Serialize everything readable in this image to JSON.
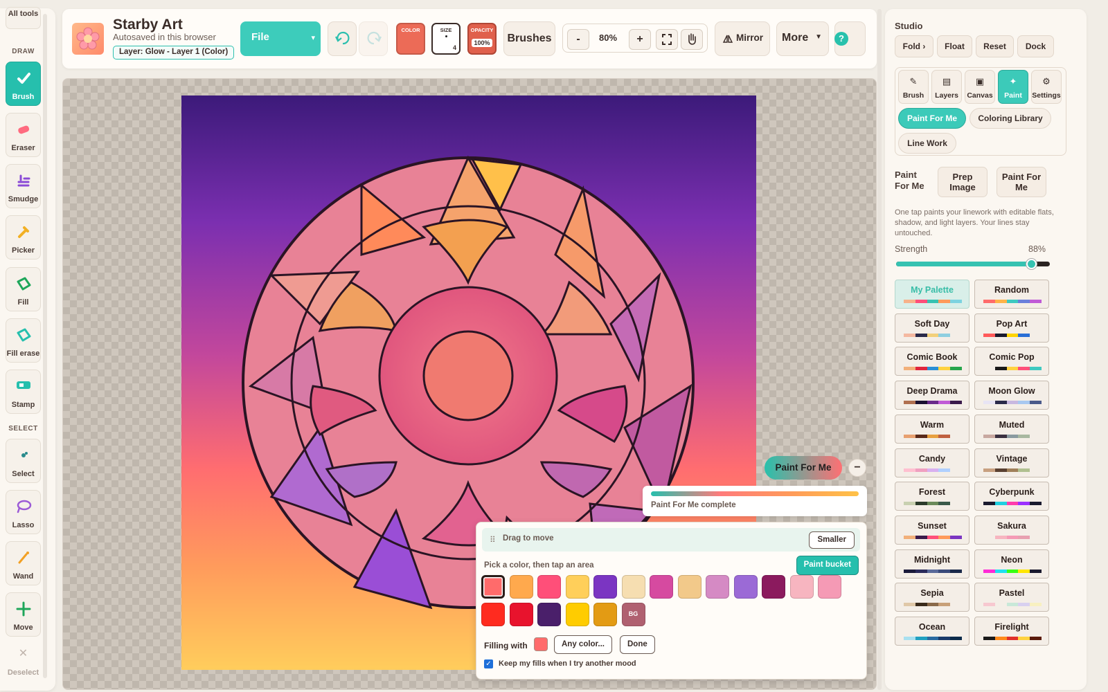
{
  "left_tools": {
    "all_tools": "All tools",
    "draw_heading": "DRAW",
    "select_heading": "SELECT",
    "brush": "Brush",
    "eraser": "Eraser",
    "smudge": "Smudge",
    "picker": "Picker",
    "fill": "Fill",
    "fill_erase": "Fill erase",
    "stamp": "Stamp",
    "select": "Select",
    "lasso": "Lasso",
    "wand": "Wand",
    "move": "Move",
    "deselect": "Deselect"
  },
  "header": {
    "app_title": "Starby Art",
    "autosave": "Autosaved in this browser",
    "layer": "Layer: Glow - Layer 1 (Color)",
    "file": "File",
    "color_label": "COLOR",
    "color_value": "#ec6b57",
    "size_label": "SIZE",
    "size_value": "4",
    "opacity_label": "OPACITY",
    "opacity_value": "100%",
    "brushes": "Brushes",
    "zoom_minus": "-",
    "zoom_level": "80%",
    "zoom_plus": "+",
    "mirror": "Mirror",
    "more": "More"
  },
  "canvas": {
    "paint_for_me_button": "Paint For Me",
    "minimize": "−",
    "progress_text": "Paint For Me complete"
  },
  "color_panel": {
    "drag_label": "Drag to move",
    "smaller": "Smaller",
    "instruction": "Pick a color, then tap an area",
    "paint_bucket": "Paint bucket",
    "row1": [
      "#ff6b6b",
      "#ffa94d",
      "#ff4f79",
      "#ffcf5a",
      "#7b35c2",
      "#f6deb1",
      "#d64aa0",
      "#f2c98a",
      "#d58ac4",
      "#9b6ad6",
      "#8b1a5e",
      "#f7b5c0",
      "#f59ab5"
    ],
    "row2": [
      "#ff2b1f",
      "#e8132d",
      "#4a1f6a",
      "#ffcc00",
      "#e39b14"
    ],
    "bg_label": "BG",
    "bg_color": "#b06070",
    "filling_with": "Filling with",
    "filling_color": "#ff6b6b",
    "any_color": "Any color...",
    "done": "Done",
    "keep_fills": "Keep my fills when I try another mood"
  },
  "studio": {
    "title": "Studio",
    "fold": "Fold ›",
    "float": "Float",
    "reset": "Reset",
    "dock": "Dock",
    "tabs": [
      "Brush",
      "Layers",
      "Canvas",
      "Paint",
      "Settings"
    ],
    "subtabs": [
      "Paint For Me",
      "Coloring Library",
      "Line Work"
    ],
    "section_label": "Paint For Me",
    "prep_image": "Prep Image",
    "paint_for_me": "Paint For Me",
    "description": "One tap paints your linework with editable flats, shadow, and light layers. Your lines stay untouched.",
    "strength_label": "Strength",
    "strength_value": "88%",
    "strength_fraction": 0.88,
    "palettes": [
      {
        "name": "My Palette",
        "colors": [
          "#f7b28a",
          "#ff4f79",
          "#36c2b1",
          "#ff9a5a",
          "#7dd3e0"
        ]
      },
      {
        "name": "Random",
        "colors": [
          "#ff6b6b",
          "#ffb347",
          "#3ec9c0",
          "#6a7fdb",
          "#c05ad6"
        ]
      },
      {
        "name": "Soft Day",
        "colors": [
          "#f4b8a0",
          "#2a2a4a",
          "#f2d07a",
          "#8ecfe0",
          "#f4eee7"
        ]
      },
      {
        "name": "Pop Art",
        "colors": [
          "#ff5a5a",
          "#1a1a2e",
          "#ffd400",
          "#2a6fd6",
          "#f4eee7"
        ]
      },
      {
        "name": "Comic Book",
        "colors": [
          "#f2b07a",
          "#e0243c",
          "#2a8fd6",
          "#ffd23f",
          "#27a54c"
        ]
      },
      {
        "name": "Comic Pop",
        "colors": [
          "#f4eee7",
          "#1a1a1a",
          "#ffd23f",
          "#ff4f79",
          "#3ec9c0"
        ]
      },
      {
        "name": "Deep Drama",
        "colors": [
          "#b07050",
          "#1a1030",
          "#6a2a8a",
          "#c05ad6",
          "#3a1a4a"
        ]
      },
      {
        "name": "Moon Glow",
        "colors": [
          "#e8e4f4",
          "#2a2a4a",
          "#c8b8e0",
          "#a8c8f0",
          "#4a5a8a"
        ]
      },
      {
        "name": "Warm",
        "colors": [
          "#e8a070",
          "#5a2a1a",
          "#e8a040",
          "#c06040",
          "#f4eee7"
        ]
      },
      {
        "name": "Muted",
        "colors": [
          "#c8a8a0",
          "#3a3040",
          "#8a9aa0",
          "#a8b8a0",
          "#f4eee7"
        ]
      },
      {
        "name": "Candy",
        "colors": [
          "#ffc0d0",
          "#f0a0c0",
          "#d8b0f0",
          "#b0d0ff",
          "#f4eee7"
        ]
      },
      {
        "name": "Vintage",
        "colors": [
          "#c8a080",
          "#5a4030",
          "#a0805a",
          "#b0c090",
          "#f4eee7"
        ]
      },
      {
        "name": "Forest",
        "colors": [
          "#c8d0b0",
          "#2a3a2a",
          "#6a8a5a",
          "#3a5a4a",
          "#f4eee7"
        ]
      },
      {
        "name": "Cyberpunk",
        "colors": [
          "#1a1a2e",
          "#20d0e0",
          "#ff3cac",
          "#9b30ff",
          "#1a1a2e"
        ]
      },
      {
        "name": "Sunset",
        "colors": [
          "#f2b07a",
          "#3a1a4a",
          "#ff4f79",
          "#ff9a5a",
          "#7b35c2"
        ]
      },
      {
        "name": "Sakura",
        "colors": [
          "#f4eee7",
          "#f7b5c0",
          "#f59ab5",
          "#e8a0b0",
          "#f4eee7"
        ]
      },
      {
        "name": "Midnight",
        "colors": [
          "#1a1a3a",
          "#2a2a5a",
          "#5a6a9a",
          "#3a4a7a",
          "#1a2a4a"
        ]
      },
      {
        "name": "Neon",
        "colors": [
          "#ff2bd6",
          "#20e0f0",
          "#39ff14",
          "#ffe600",
          "#1a1a2e"
        ]
      },
      {
        "name": "Sepia",
        "colors": [
          "#e0c8a8",
          "#3a2a1a",
          "#8a6a4a",
          "#c8a078",
          "#f4eee7"
        ]
      },
      {
        "name": "Pastel",
        "colors": [
          "#f7c8d0",
          "#f4eee7",
          "#c8e8d8",
          "#d8d0f0",
          "#f8f0c0"
        ]
      },
      {
        "name": "Ocean",
        "colors": [
          "#a8e0f0",
          "#20a0c0",
          "#2a6aa0",
          "#1a3a6a",
          "#0a2a4a"
        ]
      },
      {
        "name": "Firelight",
        "colors": [
          "#1a1a1a",
          "#ff8a1a",
          "#e0302a",
          "#ffd23f",
          "#5a1a0a"
        ]
      }
    ]
  }
}
